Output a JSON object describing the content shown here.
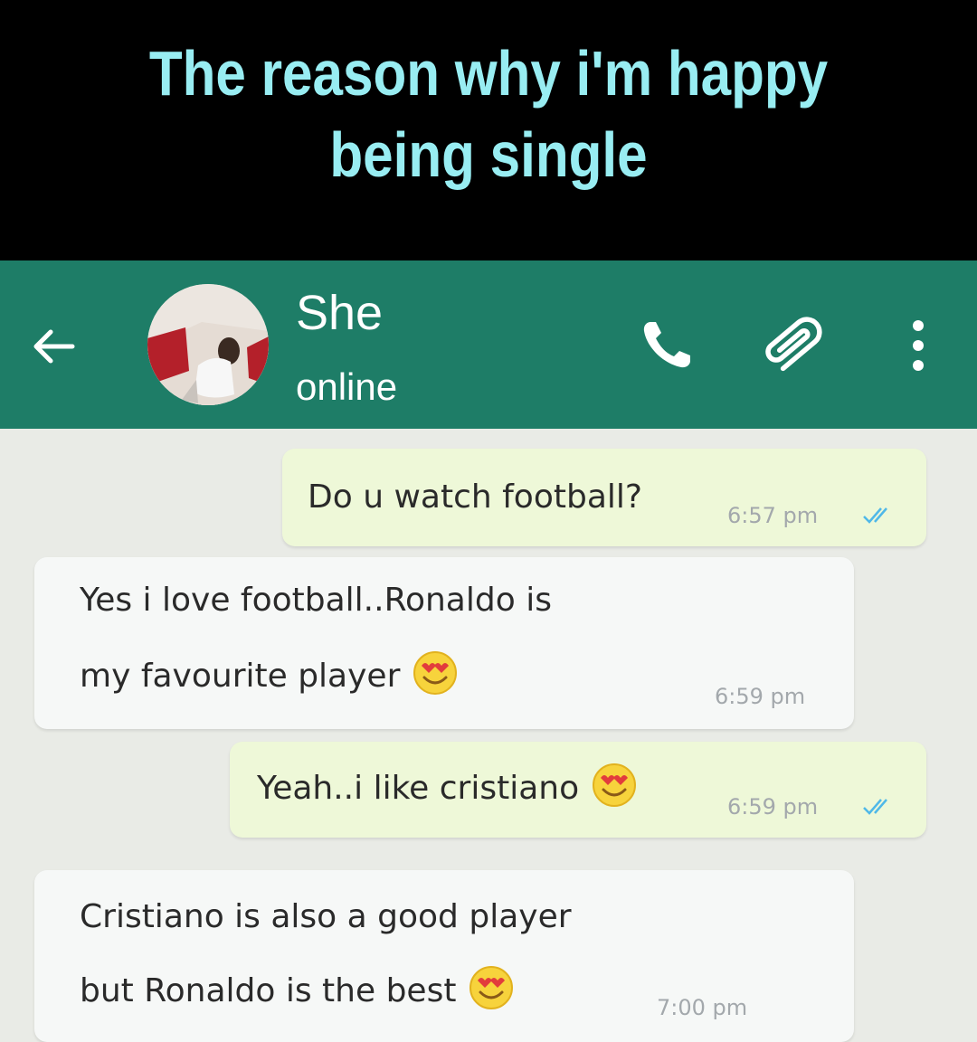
{
  "caption": {
    "line1": "The reason why i'm happy",
    "line2": "being single"
  },
  "header": {
    "contact_name": "She",
    "status": "online",
    "icons": [
      "back-arrow-icon",
      "avatar",
      "phone-icon",
      "paperclip-icon",
      "more-vert-icon"
    ],
    "color": "#1e7d67"
  },
  "messages": [
    {
      "direction": "outgoing",
      "lines": [
        "Do u watch football?"
      ],
      "time": "6:57 pm",
      "read": true
    },
    {
      "direction": "incoming",
      "lines": [
        "Yes i love football..Ronaldo is",
        "my favourite player"
      ],
      "emoji": "heart-eyes-emoji",
      "time": "6:59 pm"
    },
    {
      "direction": "outgoing",
      "lines": [
        "Yeah..i like cristiano"
      ],
      "emoji": "heart-eyes-emoji",
      "time": "6:59 pm",
      "read": true
    },
    {
      "direction": "incoming",
      "lines": [
        "Cristiano is also a good player",
        "but Ronaldo is the best"
      ],
      "emoji": "heart-eyes-emoji",
      "time": "7:00 pm"
    }
  ],
  "colors": {
    "caption_text": "#98edf2",
    "outgoing_bubble": "#eef8d8",
    "incoming_bubble": "#f6f8f7",
    "chat_background": "#e9ebe6",
    "read_ticks": "#4fb8e8"
  }
}
